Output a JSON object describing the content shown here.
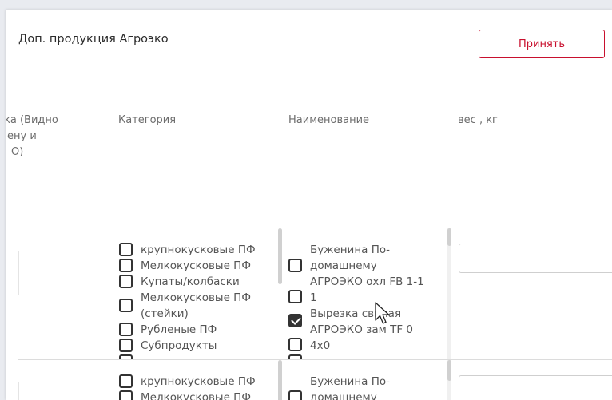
{
  "title": "Доп. продукция Агроэко",
  "accept_label": "Принять",
  "columns": {
    "partial_line1": "ка (Видно",
    "partial_line2": "ену и",
    "partial_line3": "О)",
    "category": "Категория",
    "name": "Наименование",
    "weight": "вес , кг"
  },
  "row1": {
    "categories": [
      {
        "label": "крупнокусковые ПФ",
        "checked": false
      },
      {
        "label": "Мелкокусковые ПФ",
        "checked": false
      },
      {
        "label": "Купаты/колбаски",
        "checked": false
      },
      {
        "label": "Мелкокусковые ПФ",
        "label2": "(стейки)",
        "checked": false
      },
      {
        "label": "Рубленые ПФ",
        "checked": false
      },
      {
        "label": "Субпродукты",
        "checked": false
      }
    ],
    "products": [
      {
        "label": "Буженина По-",
        "label2": "домашнему",
        "label3": "АГРОЭКО охл FB 1-1",
        "checked": false
      },
      {
        "label": "1",
        "checked": false
      },
      {
        "label": "Вырезка свиная",
        "label2": "АГРОЭКО зам TF 0",
        "checked": true
      },
      {
        "label": "4x0",
        "checked": false
      }
    ]
  },
  "row2": {
    "categories": [
      {
        "label": "крупнокусковые ПФ",
        "checked": false
      },
      {
        "label": "Мелкокусковые ПФ",
        "checked": false
      }
    ],
    "products": [
      {
        "label": "Буженина По-",
        "label2": "домашнему",
        "checked": false
      }
    ]
  }
}
